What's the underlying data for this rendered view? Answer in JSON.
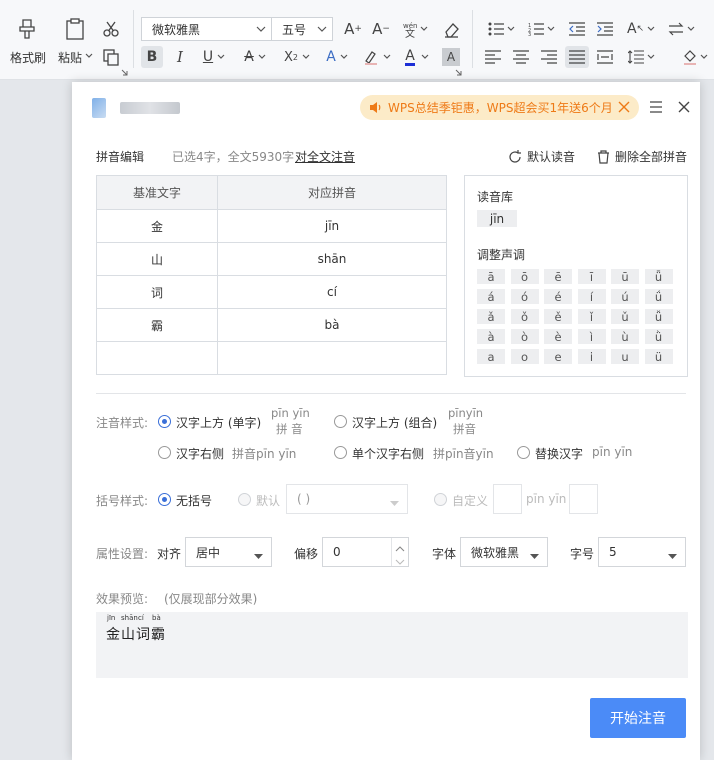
{
  "ribbon": {
    "format_painter_label": "格式刷",
    "paste_label": "粘贴",
    "font_name": "微软雅黑",
    "font_size": "五号"
  },
  "dialog": {
    "promo_text": "WPS总结季钜惠，WPS超会买1年送6个月",
    "heading": "拼音编辑",
    "selection_info": "已选4字，全文5930字",
    "full_text_link": "对全文注音",
    "default_reading_label": "默认读音",
    "delete_all_label": "删除全部拼音",
    "table": {
      "headers": [
        "基准文字",
        "对应拼音"
      ],
      "rows": [
        [
          "金",
          "jīn"
        ],
        [
          "山",
          "shān"
        ],
        [
          "词",
          "cí"
        ],
        [
          "霸",
          "bà"
        ],
        [
          "",
          ""
        ]
      ]
    },
    "reading_library_label": "读音库",
    "reading_value": "jīn",
    "tone_label": "调整声调",
    "tones": [
      [
        "ā",
        "ō",
        "ē",
        "ī",
        "ū",
        "ǖ"
      ],
      [
        "á",
        "ó",
        "é",
        "í",
        "ú",
        "ǘ"
      ],
      [
        "ǎ",
        "ǒ",
        "ě",
        "ǐ",
        "ǔ",
        "ǚ"
      ],
      [
        "à",
        "ò",
        "è",
        "ì",
        "ù",
        "ǜ"
      ],
      [
        "a",
        "o",
        "e",
        "i",
        "u",
        "ü"
      ]
    ],
    "style_label": "注音样式:",
    "style_options": [
      {
        "label": "汉字上方 (单字)",
        "sample_top": "pīn yīn",
        "sample_bottom": "拼 音",
        "selected": true
      },
      {
        "label": "汉字上方 (组合)",
        "sample_top": "pīnyīn",
        "sample_bottom": "拼音",
        "selected": false
      },
      {
        "label": "汉字右侧",
        "sample": "拼音pīn yīn",
        "selected": false
      },
      {
        "label": "单个汉字右侧",
        "sample": "拼pīn音yīn",
        "selected": false
      },
      {
        "label": "替换汉字",
        "sample": "pīn yīn",
        "selected": false
      }
    ],
    "bracket_label": "括号样式:",
    "bracket_none": "无括号",
    "bracket_default": "默认",
    "bracket_default_value": "( )",
    "bracket_custom": "自定义",
    "bracket_custom_sample": "pīn yīn",
    "attr_label": "属性设置:",
    "align_label": "对齐",
    "align_value": "居中",
    "offset_label": "偏移",
    "offset_value": "0",
    "font_label": "字体",
    "font_value": "微软雅黑",
    "size_label": "字号",
    "size_value": "5",
    "preview_label": "效果预览:",
    "preview_note": "(仅展现部分效果)",
    "preview_pinyin": [
      "jīn",
      "shān",
      "cí",
      "bà"
    ],
    "preview_text": "金山词霸",
    "start_button": "开始注音"
  },
  "colors": {
    "accent": "#4b8bf7",
    "promo_bg": "#fcebc8",
    "promo_text": "#ee7a17",
    "link": "#2f6fd6"
  }
}
